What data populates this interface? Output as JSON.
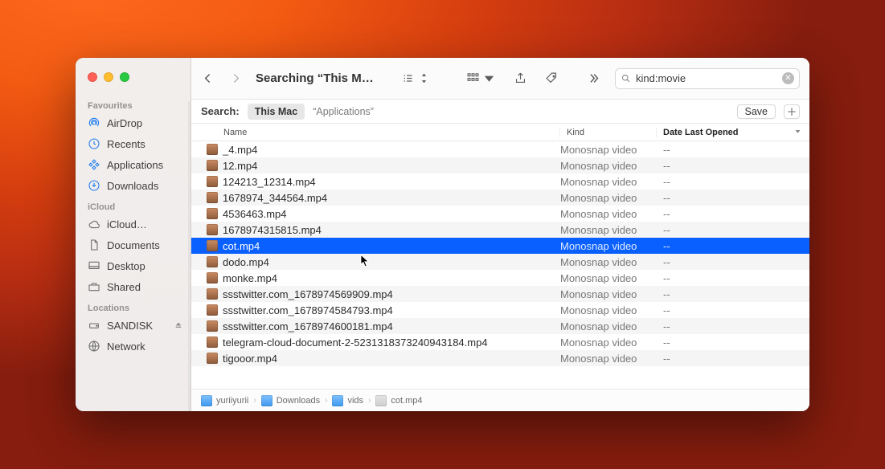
{
  "window": {
    "title": "Searching “This Mac”"
  },
  "sidebar": {
    "sections": [
      {
        "label": "Favourites",
        "items": [
          {
            "icon": "airdrop-icon",
            "label": "AirDrop"
          },
          {
            "icon": "clock-icon",
            "label": "Recents"
          },
          {
            "icon": "grid-icon",
            "label": "Applications"
          },
          {
            "icon": "download-icon",
            "label": "Downloads"
          }
        ]
      },
      {
        "label": "iCloud",
        "items": [
          {
            "icon": "cloud-icon",
            "label": "iCloud…"
          },
          {
            "icon": "doc-icon",
            "label": "Documents"
          },
          {
            "icon": "desktop-icon",
            "label": "Desktop"
          },
          {
            "icon": "shared-icon",
            "label": "Shared"
          }
        ]
      },
      {
        "label": "Locations",
        "items": [
          {
            "icon": "drive-icon",
            "label": "SANDISK",
            "eject": true
          },
          {
            "icon": "globe-icon",
            "label": "Network"
          }
        ]
      }
    ]
  },
  "toolbar": {
    "search_value": "kind:movie"
  },
  "scopebar": {
    "label": "Search:",
    "scope_selected": "This Mac",
    "scope_other": "“Applications”",
    "save_label": "Save"
  },
  "columns": {
    "name": "Name",
    "kind": "Kind",
    "date": "Date Last Opened"
  },
  "files": [
    {
      "name": "_4.mp4",
      "kind": "Monosnap video",
      "date": "--"
    },
    {
      "name": "12.mp4",
      "kind": "Monosnap video",
      "date": "--"
    },
    {
      "name": "124213_12314.mp4",
      "kind": "Monosnap video",
      "date": "--"
    },
    {
      "name": "1678974_344564.mp4",
      "kind": "Monosnap video",
      "date": "--"
    },
    {
      "name": "4536463.mp4",
      "kind": "Monosnap video",
      "date": "--"
    },
    {
      "name": "1678974315815.mp4",
      "kind": "Monosnap video",
      "date": "--"
    },
    {
      "name": "cot.mp4",
      "kind": "Monosnap video",
      "date": "--",
      "selected": true
    },
    {
      "name": "dodo.mp4",
      "kind": "Monosnap video",
      "date": "--"
    },
    {
      "name": "monke.mp4",
      "kind": "Monosnap video",
      "date": "--"
    },
    {
      "name": "ssstwitter.com_1678974569909.mp4",
      "kind": "Monosnap video",
      "date": "--"
    },
    {
      "name": "ssstwitter.com_1678974584793.mp4",
      "kind": "Monosnap video",
      "date": "--"
    },
    {
      "name": "ssstwitter.com_1678974600181.mp4",
      "kind": "Monosnap video",
      "date": "--"
    },
    {
      "name": "telegram-cloud-document-2-5231318373240943184.mp4",
      "kind": "Monosnap video",
      "date": "--"
    },
    {
      "name": "tigooor.mp4",
      "kind": "Monosnap video",
      "date": "--"
    }
  ],
  "pathbar": {
    "segments": [
      "yuriiyurii",
      "Downloads",
      "vids",
      "cot.mp4"
    ]
  }
}
